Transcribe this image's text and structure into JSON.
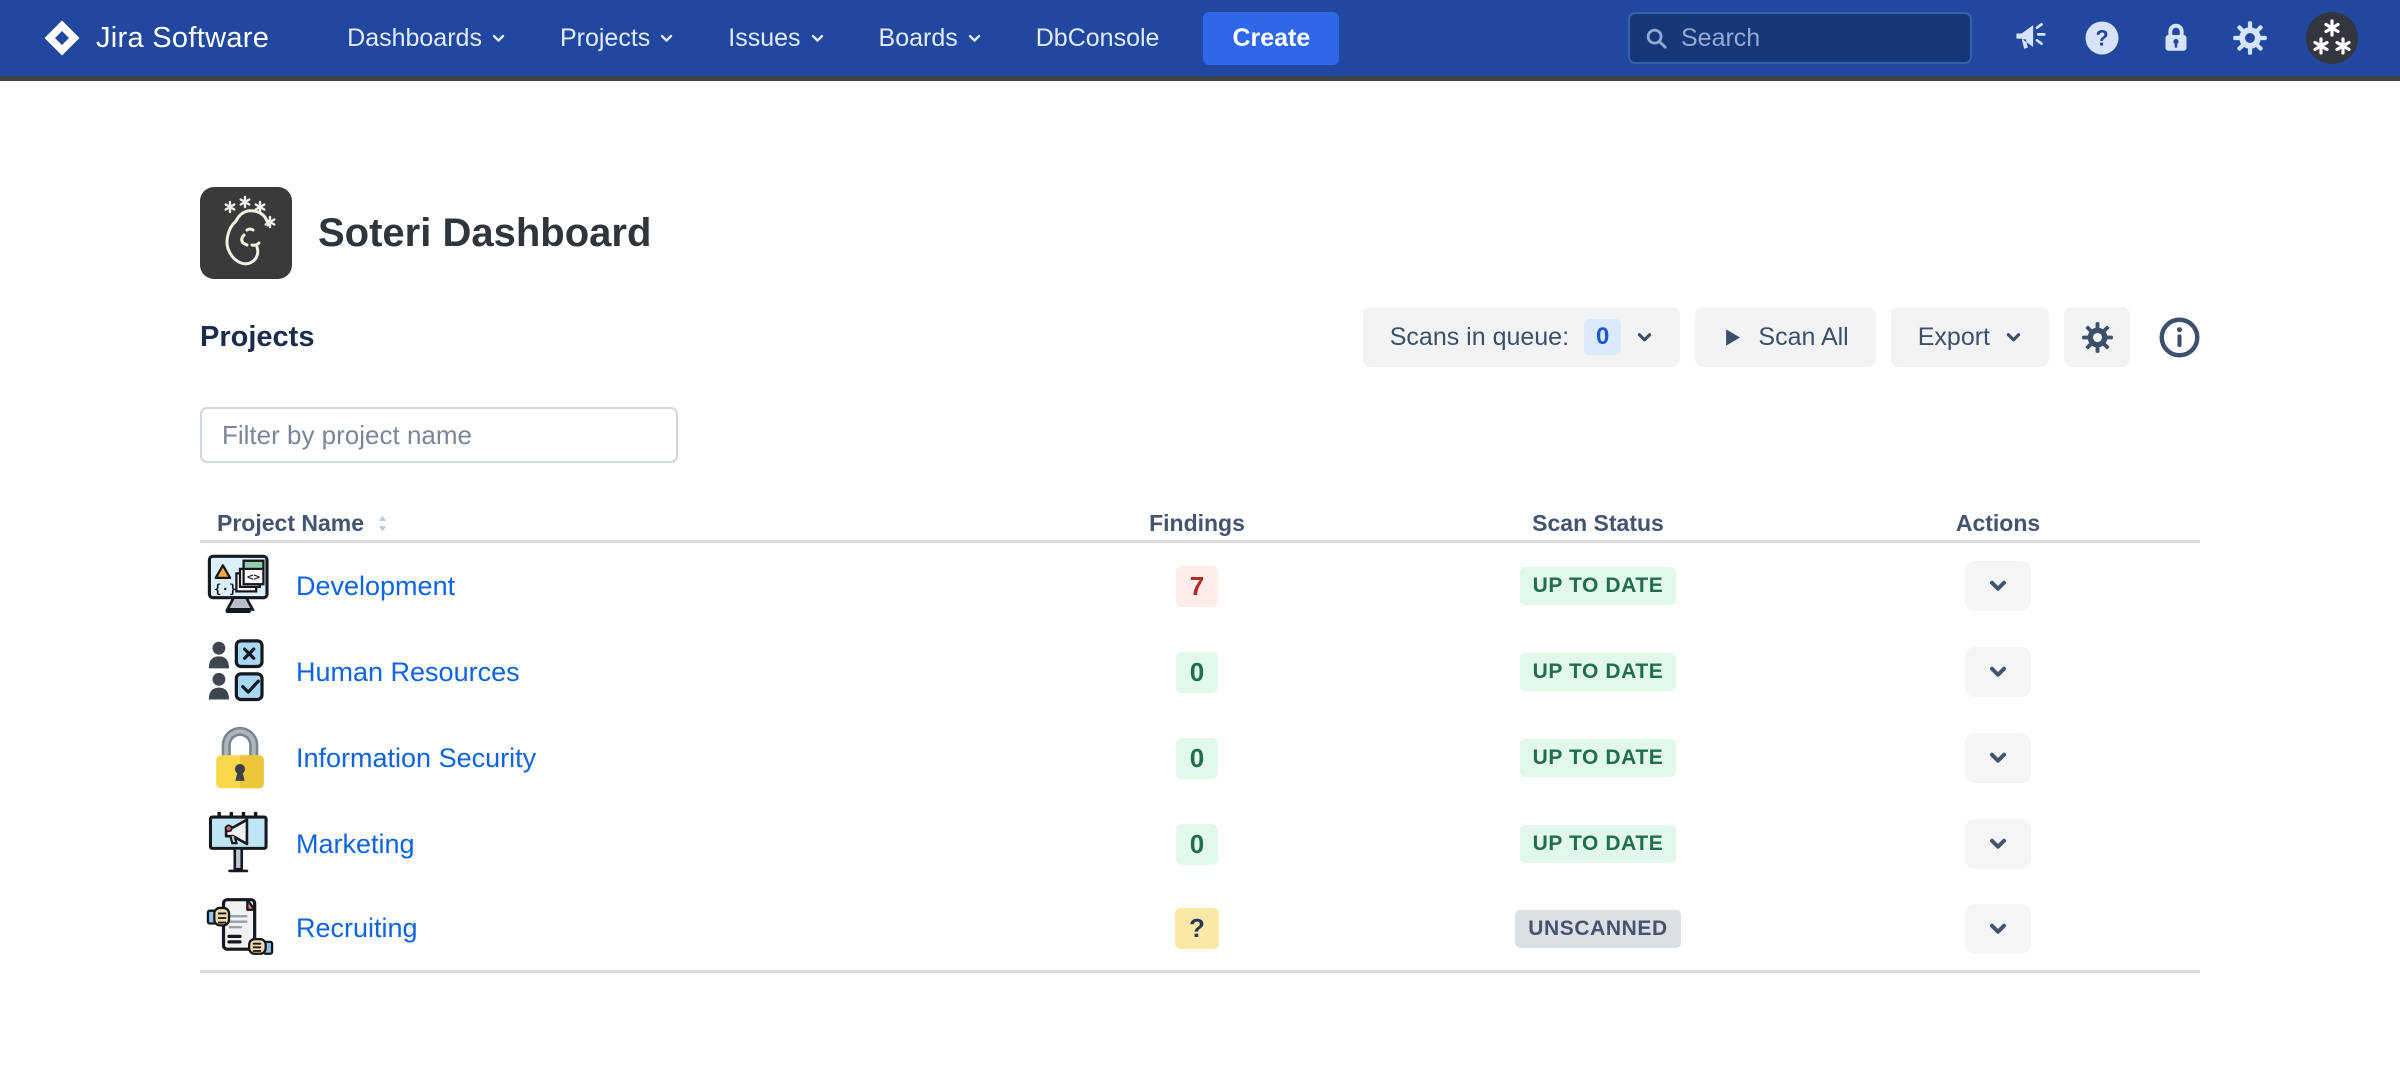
{
  "colors": {
    "navbar": "#21489e",
    "navbar-border": "#3d434d",
    "create": "#2e67e8",
    "link": "#0d63e0",
    "button-bg": "#f2f3f5",
    "button-text": "#3e4f6b",
    "chip-bg": "#dbe9fd",
    "chip-text": "#1e58c8",
    "badge-red-bg": "#fdecea",
    "badge-red-text": "#ae2e24",
    "badge-green-bg": "#e3f8ec",
    "badge-green-text": "#216e4e",
    "badge-yellow-bg": "#f9e8a6",
    "badge-yellow-text": "#253858",
    "badge-gray-bg": "#dcdfe4",
    "badge-gray-text": "#44546f"
  },
  "navbar": {
    "logo_text": "Jira Software",
    "items": [
      {
        "label": "Dashboards",
        "has_dropdown": true
      },
      {
        "label": "Projects",
        "has_dropdown": true
      },
      {
        "label": "Issues",
        "has_dropdown": true
      },
      {
        "label": "Boards",
        "has_dropdown": true
      },
      {
        "label": "DbConsole",
        "has_dropdown": false
      }
    ],
    "create_label": "Create",
    "search_placeholder": "Search",
    "icon_names": [
      "announcement-icon",
      "help-icon",
      "lock-icon",
      "settings-icon",
      "user-avatar"
    ]
  },
  "page": {
    "title": "Soteri Dashboard"
  },
  "projects": {
    "heading": "Projects",
    "filter_placeholder": "Filter by project name",
    "toolbar": {
      "scans_in_queue_label": "Scans in queue:",
      "scans_in_queue_count": "0",
      "scan_all_label": "Scan All",
      "export_label": "Export"
    },
    "table": {
      "columns": [
        "Project Name",
        "Findings",
        "Scan Status",
        "Actions"
      ],
      "rows": [
        {
          "name": "Development",
          "icon": "development",
          "findings": "7",
          "findings_tone": "red",
          "status": "UP TO DATE",
          "status_tone": "green"
        },
        {
          "name": "Human Resources",
          "icon": "human-resources",
          "findings": "0",
          "findings_tone": "green",
          "status": "UP TO DATE",
          "status_tone": "green"
        },
        {
          "name": "Information Security",
          "icon": "information-security",
          "findings": "0",
          "findings_tone": "green",
          "status": "UP TO DATE",
          "status_tone": "green"
        },
        {
          "name": "Marketing",
          "icon": "marketing",
          "findings": "0",
          "findings_tone": "green",
          "status": "UP TO DATE",
          "status_tone": "green"
        },
        {
          "name": "Recruiting",
          "icon": "recruiting",
          "findings": "?",
          "findings_tone": "yellow",
          "status": "UNSCANNED",
          "status_tone": "gray"
        }
      ]
    }
  }
}
